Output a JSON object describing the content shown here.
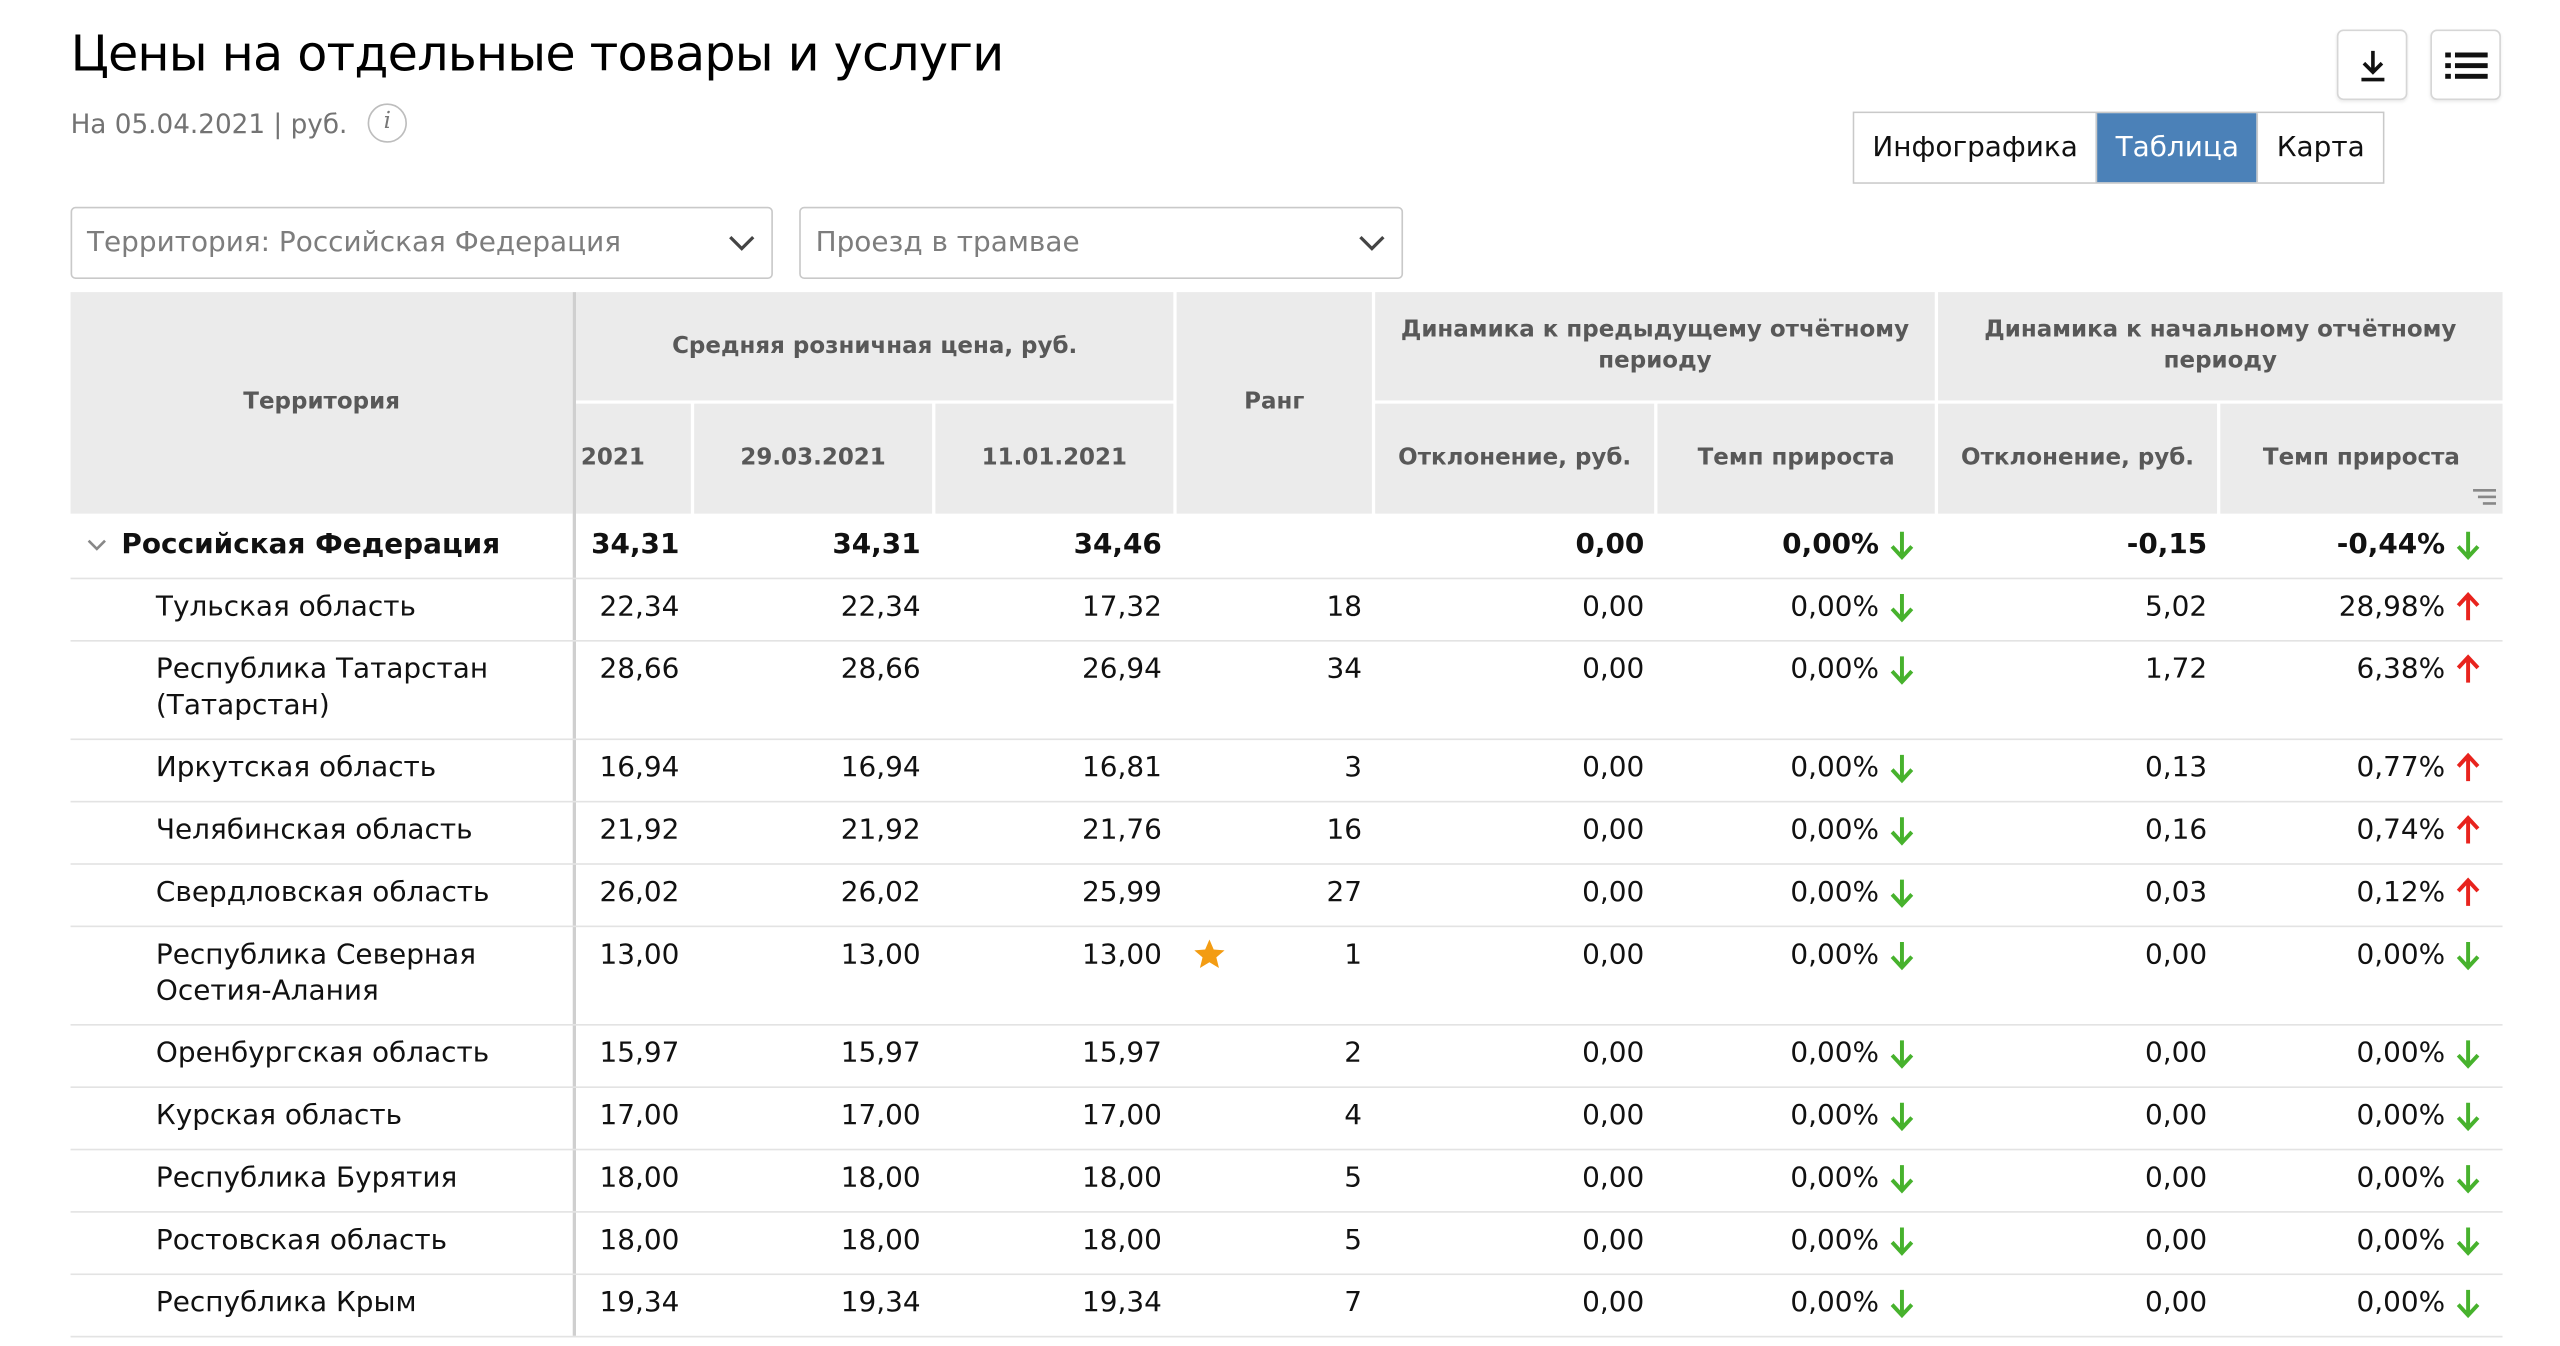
{
  "header": {
    "title": "Цены на отдельные товары и услуги",
    "subtitle": "На 05.04.2021 | руб.",
    "info_icon": "info-icon"
  },
  "toolbar": {
    "download_icon": "download-icon",
    "menu_icon": "list-menu-icon"
  },
  "view_tabs": [
    {
      "label": "Инфографика",
      "active": false
    },
    {
      "label": "Таблица",
      "active": true
    },
    {
      "label": "Карта",
      "active": false
    }
  ],
  "filters": {
    "territory": "Территория: Российская  Федерация",
    "service": "Проезд в трамвае"
  },
  "table": {
    "headers": {
      "territory": "Территория",
      "avg_price": "Средняя розничная цена, руб.",
      "date1": "2021",
      "date2": "29.03.2021",
      "date3": "11.01.2021",
      "rank": "Ранг",
      "dyn_prev": "Динамика к предыдущему отчётному периоду",
      "dyn_start": "Динамика к начальному отчётному периоду",
      "deviation": "Отклонение, руб.",
      "growth": "Темп прироста"
    },
    "rows": [
      {
        "name": "Российская Федерация",
        "bold": true,
        "p1": "34,31",
        "p2": "34,31",
        "p3": "34,46",
        "rank": "",
        "star": false,
        "dev_prev": "0,00",
        "rate_prev": "0,00%",
        "dir_prev": "down",
        "dev_start": "-0,15",
        "rate_start": "-0,44%",
        "dir_start": "down"
      },
      {
        "name": "Тульская область",
        "p1": "22,34",
        "p2": "22,34",
        "p3": "17,32",
        "rank": "18",
        "dev_prev": "0,00",
        "rate_prev": "0,00%",
        "dir_prev": "down",
        "dev_start": "5,02",
        "rate_start": "28,98%",
        "dir_start": "up"
      },
      {
        "name": "Республика Татарстан (Татарстан)",
        "p1": "28,66",
        "p2": "28,66",
        "p3": "26,94",
        "rank": "34",
        "dev_prev": "0,00",
        "rate_prev": "0,00%",
        "dir_prev": "down",
        "dev_start": "1,72",
        "rate_start": "6,38%",
        "dir_start": "up"
      },
      {
        "name": "Иркутская область",
        "p1": "16,94",
        "p2": "16,94",
        "p3": "16,81",
        "rank": "3",
        "dev_prev": "0,00",
        "rate_prev": "0,00%",
        "dir_prev": "down",
        "dev_start": "0,13",
        "rate_start": "0,77%",
        "dir_start": "up"
      },
      {
        "name": "Челябинская область",
        "p1": "21,92",
        "p2": "21,92",
        "p3": "21,76",
        "rank": "16",
        "dev_prev": "0,00",
        "rate_prev": "0,00%",
        "dir_prev": "down",
        "dev_start": "0,16",
        "rate_start": "0,74%",
        "dir_start": "up"
      },
      {
        "name": "Свердловская область",
        "p1": "26,02",
        "p2": "26,02",
        "p3": "25,99",
        "rank": "27",
        "dev_prev": "0,00",
        "rate_prev": "0,00%",
        "dir_prev": "down",
        "dev_start": "0,03",
        "rate_start": "0,12%",
        "dir_start": "up"
      },
      {
        "name": "Республика Северная Осетия-Алания",
        "p1": "13,00",
        "p2": "13,00",
        "p3": "13,00",
        "rank": "1",
        "star": true,
        "dev_prev": "0,00",
        "rate_prev": "0,00%",
        "dir_prev": "down",
        "dev_start": "0,00",
        "rate_start": "0,00%",
        "dir_start": "down"
      },
      {
        "name": "Оренбургская область",
        "p1": "15,97",
        "p2": "15,97",
        "p3": "15,97",
        "rank": "2",
        "dev_prev": "0,00",
        "rate_prev": "0,00%",
        "dir_prev": "down",
        "dev_start": "0,00",
        "rate_start": "0,00%",
        "dir_start": "down"
      },
      {
        "name": "Курская область",
        "p1": "17,00",
        "p2": "17,00",
        "p3": "17,00",
        "rank": "4",
        "dev_prev": "0,00",
        "rate_prev": "0,00%",
        "dir_prev": "down",
        "dev_start": "0,00",
        "rate_start": "0,00%",
        "dir_start": "down"
      },
      {
        "name": "Республика Бурятия",
        "p1": "18,00",
        "p2": "18,00",
        "p3": "18,00",
        "rank": "5",
        "dev_prev": "0,00",
        "rate_prev": "0,00%",
        "dir_prev": "down",
        "dev_start": "0,00",
        "rate_start": "0,00%",
        "dir_start": "down"
      },
      {
        "name": "Ростовская область",
        "p1": "18,00",
        "p2": "18,00",
        "p3": "18,00",
        "rank": "5",
        "dev_prev": "0,00",
        "rate_prev": "0,00%",
        "dir_prev": "down",
        "dev_start": "0,00",
        "rate_start": "0,00%",
        "dir_start": "down"
      },
      {
        "name": "Республика Крым",
        "p1": "19,34",
        "p2": "19,34",
        "p3": "19,34",
        "rank": "7",
        "dev_prev": "0,00",
        "rate_prev": "0,00%",
        "dir_prev": "down",
        "dev_start": "0,00",
        "rate_start": "0,00%",
        "dir_start": "down"
      }
    ]
  },
  "colors": {
    "accent": "#4b81b8",
    "arrow_up": "#e8231d",
    "arrow_down": "#47b22d",
    "star": "#f39c12"
  }
}
